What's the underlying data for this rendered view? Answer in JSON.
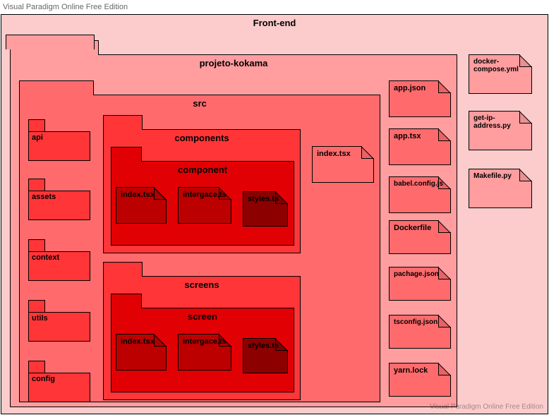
{
  "app_header": "Visual Paradigm Online Free Edition",
  "watermark": "Visual Paradigm Online Free Edition",
  "front_end": "Front-end",
  "projeto": "projeto-kokama",
  "src": "src",
  "side_pkgs": {
    "api": "api",
    "assets": "assets",
    "context": "context",
    "utils": "utils",
    "config": "config"
  },
  "components": "components",
  "component": "component",
  "screens": "screens",
  "screen": "screen",
  "files": {
    "index": "index.tsx",
    "intergace": "intergace.ts",
    "styles": "styles.ts",
    "src_index": "index.tsx",
    "app_json": "app.json",
    "app_tsx": "app.tsx",
    "babel": "babel.config.js",
    "dockerfile": "Dockerfile",
    "pachage": "pachage.json",
    "tsconfig": "tsconfig.json",
    "yarn": "yarn.lock",
    "docker_compose": "docker-compose.yml",
    "get_ip": "get-ip-address.py",
    "makefile": "Makefile.py"
  }
}
